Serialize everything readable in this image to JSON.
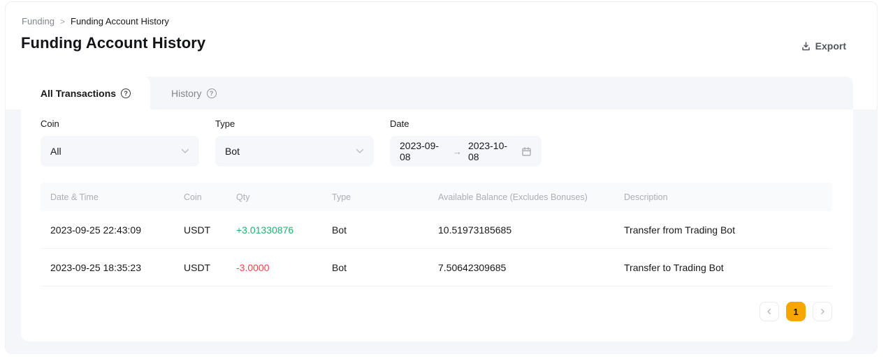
{
  "breadcrumb": {
    "items": [
      "Funding",
      "Funding Account History"
    ],
    "separator": ">"
  },
  "header": {
    "title": "Funding Account History",
    "export_label": "Export"
  },
  "tabs": [
    {
      "label": "All Transactions",
      "active": true
    },
    {
      "label": "History",
      "active": false
    }
  ],
  "icons": {
    "help_glyph": "?",
    "export": "download-icon",
    "date_picker": "calendar-icon",
    "select_caret": "chevron-down-icon"
  },
  "filters": {
    "coin": {
      "label": "Coin",
      "value": "All"
    },
    "type": {
      "label": "Type",
      "value": "Bot"
    },
    "date": {
      "label": "Date",
      "start": "2023-09-08",
      "range_arrow": "→",
      "end": "2023-10-08"
    }
  },
  "table": {
    "columns": [
      "Date & Time",
      "Coin",
      "Qty",
      "Type",
      "Available Balance (Excludes Bonuses)",
      "Description"
    ],
    "rows": [
      {
        "datetime": "2023-09-25 22:43:09",
        "coin": "USDT",
        "qty": "+3.01330876",
        "qty_direction": "positive",
        "type": "Bot",
        "balance": "10.51973185685",
        "description": "Transfer from Trading Bot"
      },
      {
        "datetime": "2023-09-25 18:35:23",
        "coin": "USDT",
        "qty": "-3.0000",
        "qty_direction": "negative",
        "type": "Bot",
        "balance": "7.50642309685",
        "description": "Transfer to Trading Bot"
      }
    ]
  },
  "pagination": {
    "current_page": "1",
    "pages": [
      "1"
    ]
  },
  "colors": {
    "accent": "#f7a600",
    "positive": "#20b26c",
    "negative": "#ef454a",
    "page_background": "#f4f6fa",
    "muted_text": "#81858c"
  }
}
